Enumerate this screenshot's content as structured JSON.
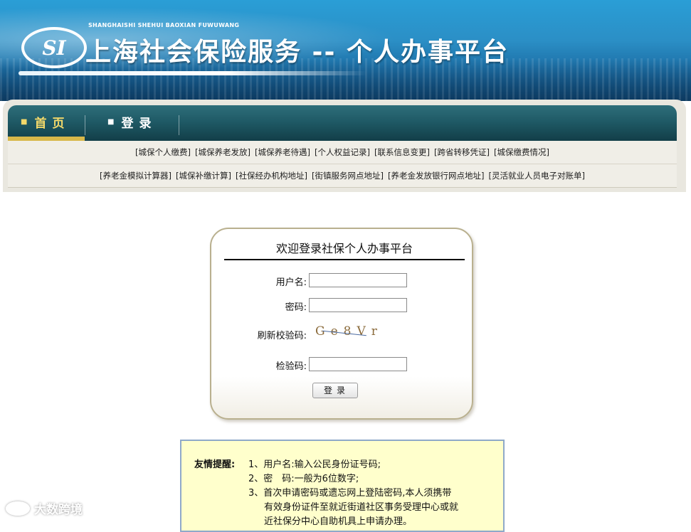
{
  "header": {
    "logo_text": "SI",
    "pinyin": "SHANGHAISHI SHEHUI BAOXIAN FUWUWANG",
    "title": "上海社会保险服务 -- 个人办事平台"
  },
  "nav": {
    "items": [
      {
        "label": "首页",
        "active": true
      },
      {
        "label": "登录",
        "active": false
      }
    ]
  },
  "quick_links": {
    "row1": [
      "[城保个人缴费]",
      "[城保养老发放]",
      "[城保养老待遇]",
      "[个人权益记录]",
      "[联系信息变更]",
      "[跨省转移凭证]",
      "[城保缴费情况]"
    ],
    "row2": [
      "[养老金模拟计算器]",
      "[城保补缴计算]",
      "[社保经办机构地址]",
      "[街镇服务网点地址]",
      "[养老金发放银行网点地址]",
      "[灵活就业人员电子对账单]"
    ]
  },
  "login": {
    "title": "欢迎登录社保个人办事平台",
    "username_label": "用户名:",
    "username_value": "",
    "password_label": "密码:",
    "password_value": "",
    "captcha_refresh_label": "刷新校验码:",
    "captcha_text": "Ge8Vr",
    "verify_label": "检验码:",
    "verify_value": "",
    "submit_label": "登录"
  },
  "notice": {
    "heading": "友情提醒:",
    "lines": [
      "1、用户名:输入公民身份证号码;",
      "2、密　码:一般为6位数字;",
      "3、首次申请密码或遗忘网上登陆密码,本人须携带",
      "有效身份证件至就近街道社区事务受理中心或就",
      "近社保分中心自助机具上申请办理。"
    ]
  },
  "watermark": {
    "text": "大数跨境"
  },
  "colors": {
    "banner": "#2a9ed6",
    "navbar": "#1f5a66",
    "nav_active": "#f3d86a",
    "notice_bg": "#ffffcc",
    "notice_border": "#8fa9c9"
  }
}
